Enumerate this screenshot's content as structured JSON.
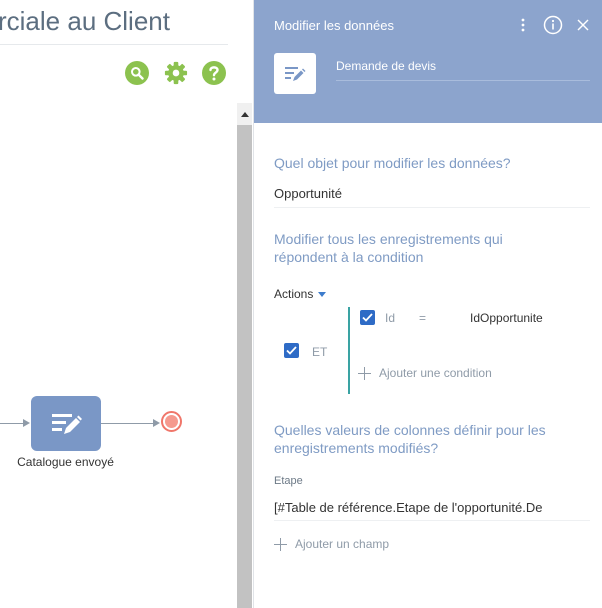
{
  "designer": {
    "title": "rciale au Client",
    "toolbar": {
      "search_icon": "magnifier-icon",
      "settings_icon": "gear-icon",
      "help_icon": "question-icon"
    },
    "task": {
      "label": "Catalogue envoyé",
      "icon": "edit-data-icon"
    },
    "colors": {
      "node": "#7a97c6",
      "end_event": "#f0766a",
      "toolbar": "#8cc24f"
    }
  },
  "panel": {
    "title": "Modifier les données",
    "header_icons": [
      "more-vertical-icon",
      "info-icon",
      "close-icon"
    ],
    "element_name": "Demande de devis",
    "object_question": "Quel objet pour modifier les données?",
    "object_value": "Opportunité",
    "condition_question": "Modifier tous les enregistrements qui répondent à la condition",
    "actions_label": "Actions",
    "group_operator": "ET",
    "condition": {
      "column": "Id",
      "operator": "=",
      "value": "IdOpportunite"
    },
    "add_condition_label": "Ajouter une condition",
    "columns_question": "Quelles valeurs de colonnes définir pour les enregistrements modifiés?",
    "field_caption": "Etape",
    "field_value": "[#Table de référence.Etape de l'opportunité.De",
    "add_field_label": "Ajouter un champ",
    "colors": {
      "header": "#8ca4cd",
      "question": "#7f9bc4",
      "checkbox": "#2e6bc6",
      "group_bar": "#3aa3a3"
    }
  }
}
